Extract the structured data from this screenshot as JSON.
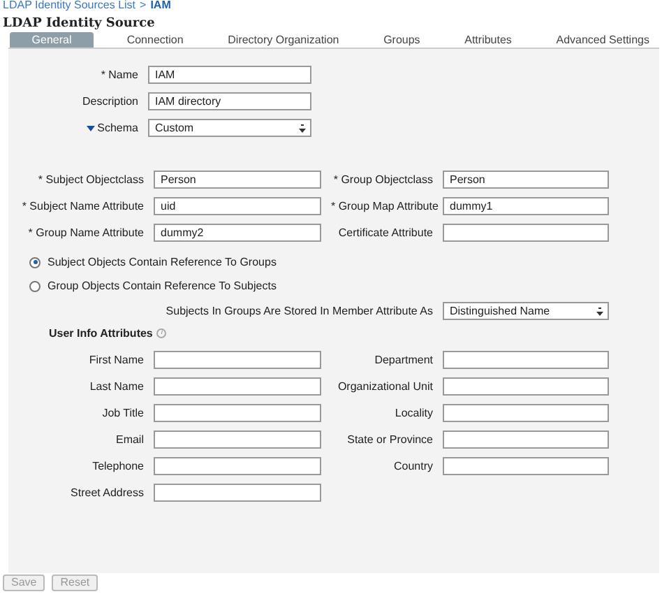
{
  "breadcrumb": {
    "parent": "LDAP Identity Sources List",
    "separator": ">",
    "current": "IAM"
  },
  "title": "LDAP Identity Source",
  "tabs": [
    {
      "label": "General",
      "selected": true
    },
    {
      "label": "Connection",
      "selected": false
    },
    {
      "label": "Directory Organization",
      "selected": false
    },
    {
      "label": "Groups",
      "selected": false
    },
    {
      "label": "Attributes",
      "selected": false
    },
    {
      "label": "Advanced Settings",
      "selected": false
    }
  ],
  "general": [
    {
      "label": "* Name",
      "kind": "text",
      "value": "IAM"
    },
    {
      "label": "Description",
      "kind": "text",
      "value": "IAM directory"
    },
    {
      "label": "Schema",
      "kind": "select",
      "value": "Custom"
    }
  ],
  "schema_attributes": [
    {
      "label": "* Subject Objectclass",
      "value": "Person"
    },
    {
      "label": "* Group Objectclass",
      "value": "Person"
    },
    {
      "label": "* Subject Name Attribute",
      "value": "uid"
    },
    {
      "label": "* Group Map Attribute",
      "value": "dummy1"
    },
    {
      "label": "* Group Name Attribute",
      "value": "dummy2"
    },
    {
      "label": "Certificate Attribute"
    }
  ],
  "reference_options": [
    {
      "label": "Subject Objects Contain Reference To Groups",
      "selected": true
    },
    {
      "label": "Group Objects Contain Reference To Subjects",
      "selected": false
    }
  ],
  "member_attribute": {
    "label": "Subjects In Groups Are Stored In Member Attribute As",
    "value": "Distinguished Name"
  },
  "user_info": {
    "title": "User Info Attributes",
    "info_icon": "i",
    "fields": [
      {
        "label": "First Name"
      },
      {
        "label": "Department"
      },
      {
        "label": "Last Name"
      },
      {
        "label": "Organizational Unit"
      },
      {
        "label": "Job Title"
      },
      {
        "label": "Locality"
      },
      {
        "label": "Email"
      },
      {
        "label": "State or Province"
      },
      {
        "label": "Telephone"
      },
      {
        "label": "Country"
      },
      {
        "label": "Street Address"
      }
    ]
  },
  "buttons": [
    {
      "label": "Save",
      "disabled": true
    },
    {
      "label": "Reset",
      "disabled": true
    }
  ]
}
